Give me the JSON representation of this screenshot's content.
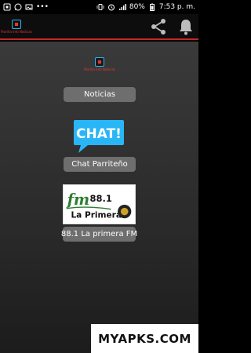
{
  "status_bar": {
    "battery": "80%",
    "time": "7:53 p. m.",
    "left_icons": [
      "app-notification-icon",
      "whatsapp-icon",
      "image-icon",
      "more-dots-icon"
    ],
    "right_icons": [
      "vibrate-icon",
      "alarm-icon",
      "signal-icon",
      "battery-icon"
    ]
  },
  "app_bar": {
    "logo_caption": "Parrilla Info Noticias",
    "actions": [
      "share-icon",
      "notifications-icon"
    ]
  },
  "main": {
    "logo_caption": "Parrilla Info Noticias",
    "buttons": {
      "noticias": "Noticias",
      "chat": "Chat Parriteño",
      "radio": "88.1 La primera FM"
    },
    "chat_icon_text": "CHAT!",
    "radio_logo": {
      "fm": "fm",
      "frequency": "88.1",
      "name": "La Primera"
    }
  },
  "watermark": {
    "text": "MYAPKS.COM"
  },
  "colors": {
    "accent_red": "#c62828",
    "chat_blue": "#29b6f6",
    "pill_gray": "#6e6e6e",
    "fm_green": "#2e7d32"
  }
}
